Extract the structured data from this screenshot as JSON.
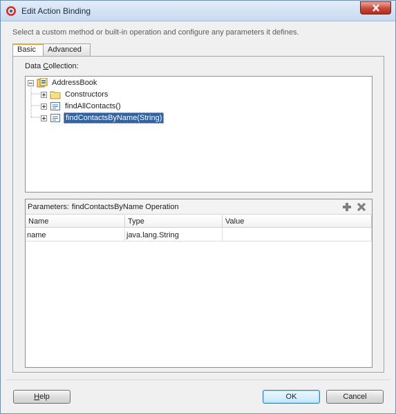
{
  "window": {
    "title": "Edit Action Binding",
    "description": "Select a custom method or built-in operation and configure any parameters it defines."
  },
  "tabs": [
    {
      "label": "Basic",
      "active": true
    },
    {
      "label": "Advanced",
      "active": false
    }
  ],
  "data_collection": {
    "label_prefix": "Data ",
    "label_mnemonic": "C",
    "label_suffix": "ollection:",
    "tree": {
      "root": {
        "label": "AddressBook",
        "icon": "data-control-icon",
        "expanded": true
      },
      "children": [
        {
          "label": "Constructors",
          "icon": "folder-icon",
          "selected": false
        },
        {
          "label": "findAllContacts()",
          "icon": "method-icon",
          "selected": false
        },
        {
          "label": "findContactsByName(String)",
          "icon": "method-icon",
          "selected": true
        }
      ]
    }
  },
  "parameters": {
    "label": "Parameters:",
    "operation": "findContactsByName Operation",
    "columns": [
      "Name",
      "Type",
      "Value"
    ],
    "rows": [
      {
        "name": "name",
        "type": "java.lang.String",
        "value": ""
      }
    ]
  },
  "buttons": {
    "help_mnemonic": "H",
    "help_rest": "elp",
    "ok": "OK",
    "cancel": "Cancel"
  },
  "colors": {
    "selection": "#3163a4",
    "close_button": "#c7483a",
    "active_tab_accent": "#f0a32c"
  }
}
